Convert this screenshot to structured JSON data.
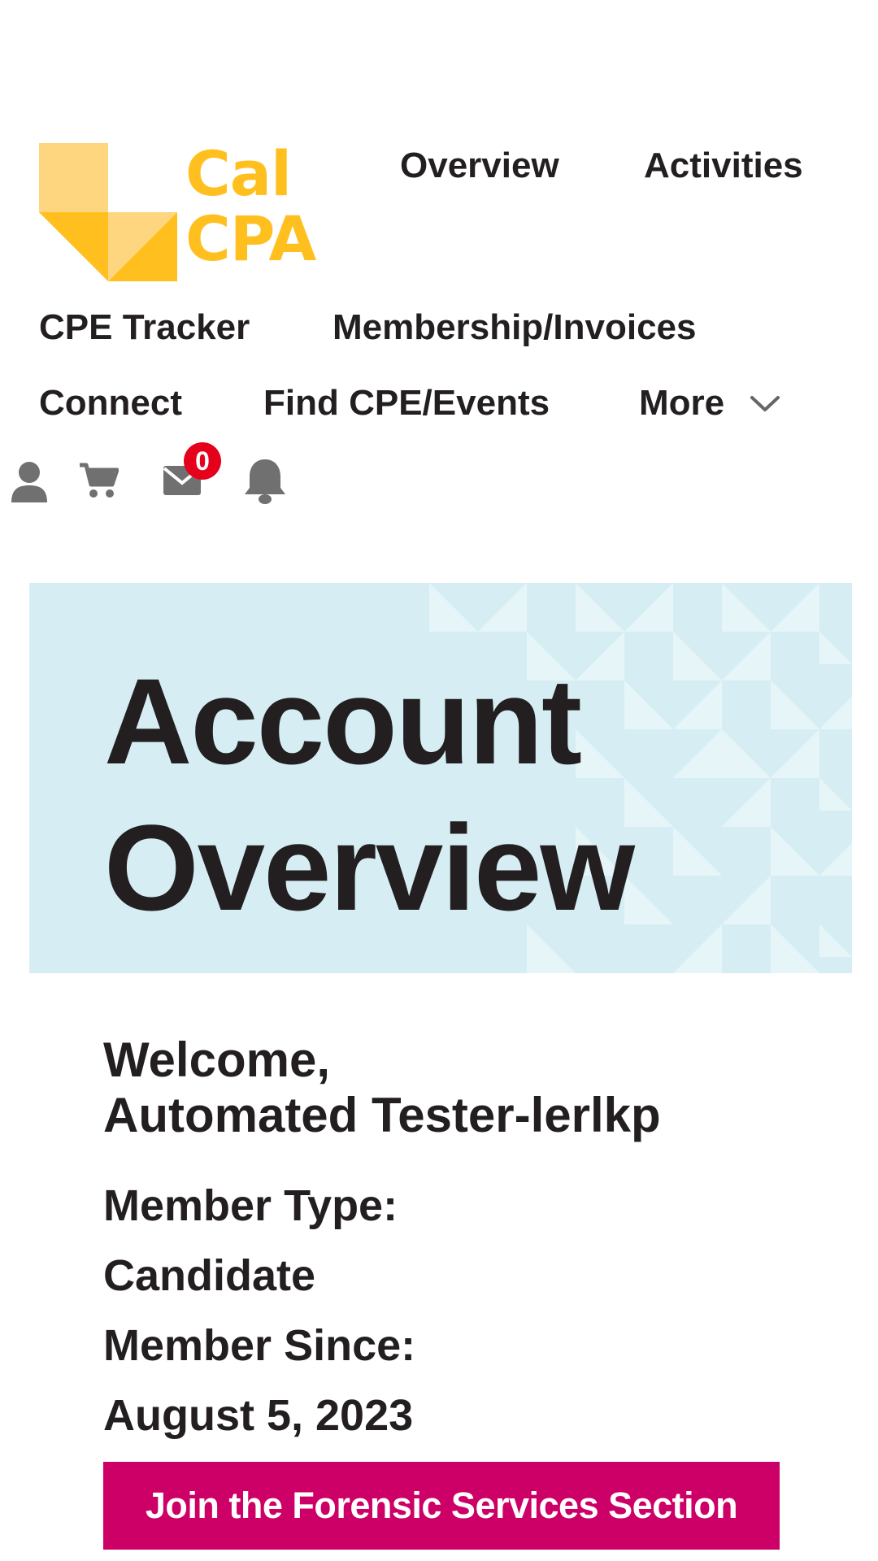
{
  "brand": {
    "logo_line1": "Cal",
    "logo_line2": "CPA",
    "logo_color": "#ffc01f",
    "logo_light_color": "#ffd680"
  },
  "nav": {
    "overview": "Overview",
    "activities": "Activities",
    "cpe_tracker": "CPE Tracker",
    "membership": "Membership/Invoices",
    "connect": "Connect",
    "find_cpe": "Find CPE/Events",
    "more": "More"
  },
  "icons": {
    "profile": "user-icon",
    "cart": "cart-icon",
    "messages": "mail-icon",
    "notifications": "bell-icon",
    "more": "chevron-down-icon"
  },
  "messages_badge_count": "0",
  "hero": {
    "title_line1": "Account",
    "title_line2": "Overview",
    "background_color": "#d6eef3"
  },
  "account": {
    "welcome_label": "Welcome,",
    "user_name": "Automated Tester-lerlkp",
    "member_type_label": "Member Type:",
    "member_type_value": "Candidate",
    "member_since_label": "Member Since:",
    "member_since_value": "August 5, 2023"
  },
  "cta": {
    "label": "Join the Forensic Services Section",
    "color": "#cc0066"
  }
}
